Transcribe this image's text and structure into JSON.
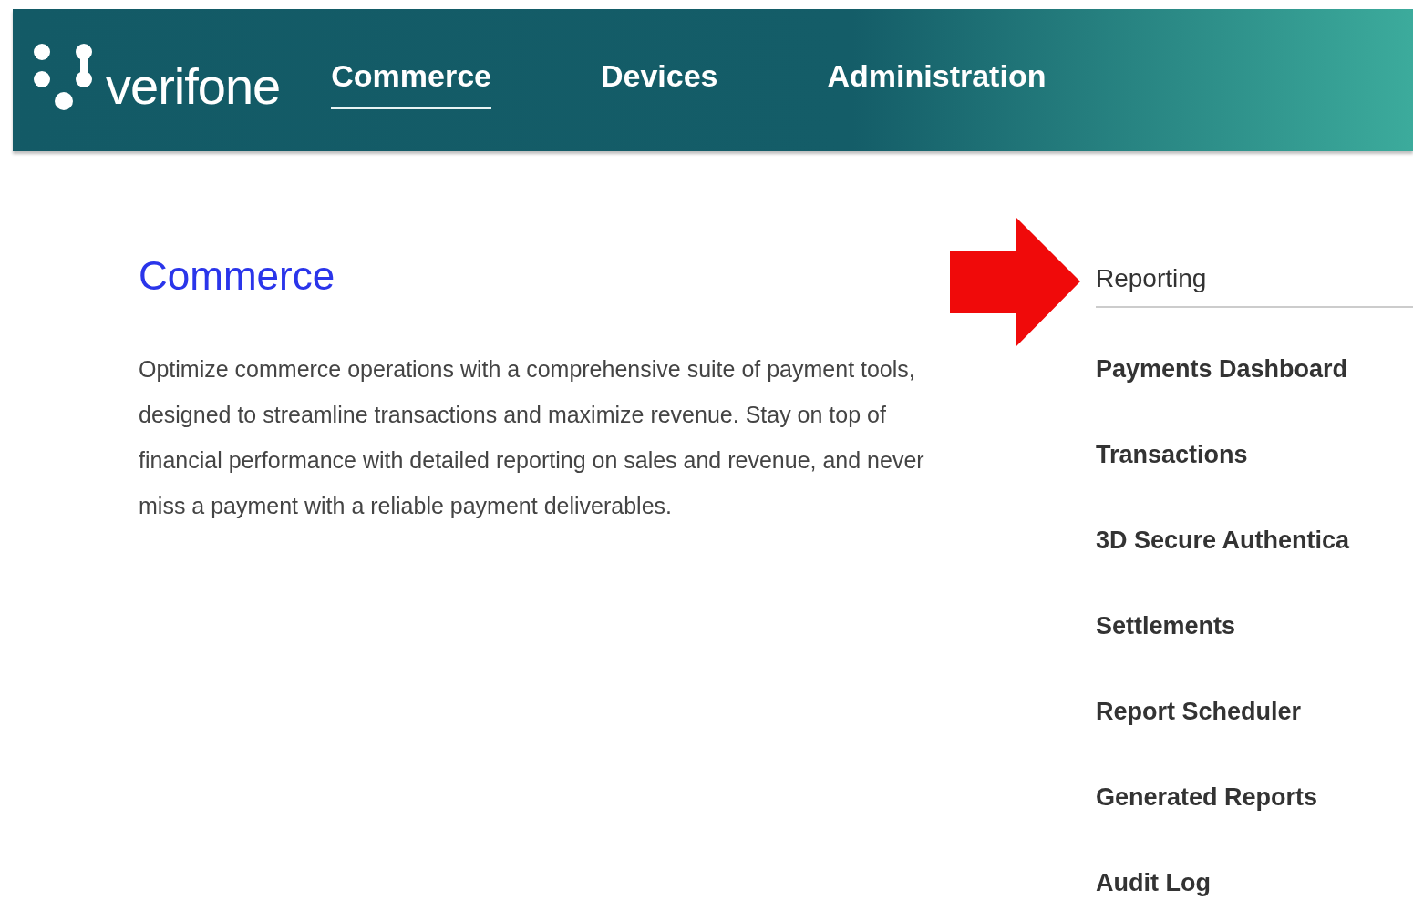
{
  "header": {
    "logo": "verifone",
    "nav": [
      {
        "label": "Commerce",
        "selected": true
      },
      {
        "label": "Devices",
        "selected": false
      },
      {
        "label": "Administration",
        "selected": false
      }
    ]
  },
  "section": {
    "title": "Commerce",
    "description": "Optimize commerce operations with a comprehensive suite of payment tools, designed to streamline transactions and maximize revenue. Stay on top of financial performance with detailed reporting on sales and revenue, and never miss a payment with a reliable payment deliverables."
  },
  "menu": {
    "heading": "Reporting",
    "items": [
      "Payments Dashboard",
      "Transactions",
      "3D Secure Authentica",
      "Settlements",
      "Report Scheduler",
      "Generated Reports",
      "Audit Log"
    ]
  }
}
